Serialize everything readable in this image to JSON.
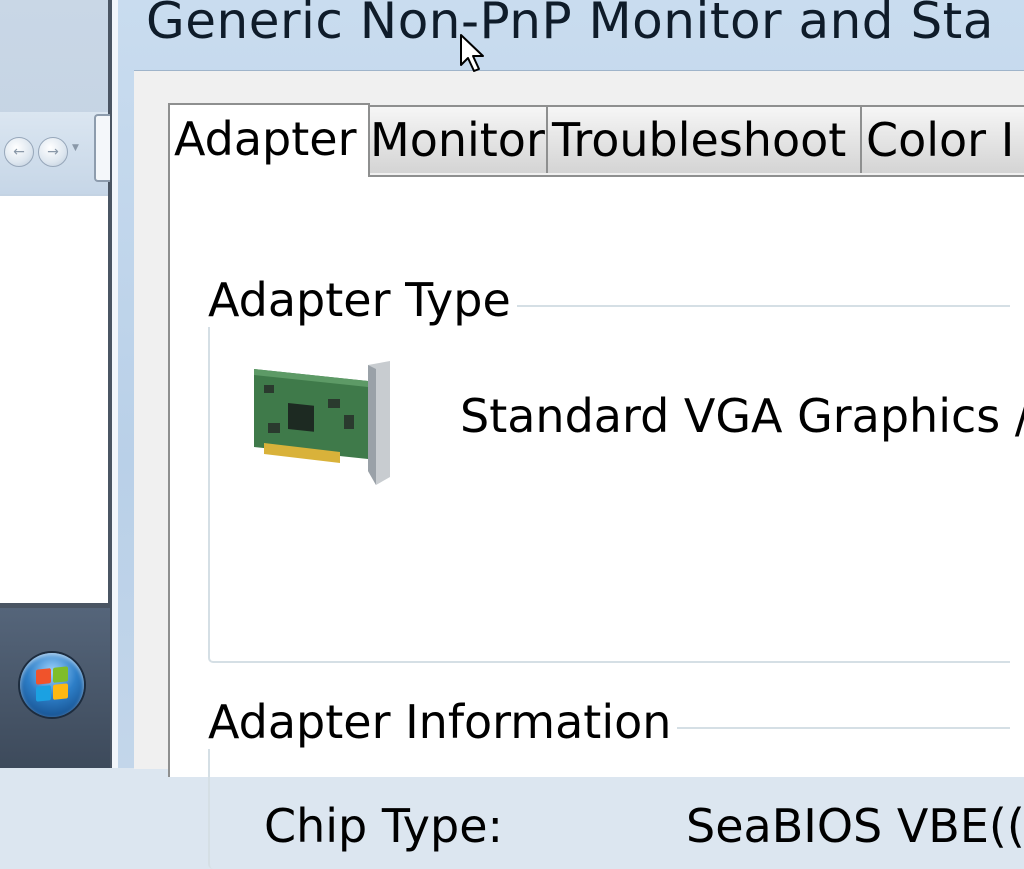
{
  "dialog": {
    "title": "Generic Non-PnP Monitor and Sta",
    "tabs": [
      {
        "label": "Adapter",
        "selected": true
      },
      {
        "label": "Monitor",
        "selected": false
      },
      {
        "label": "Troubleshoot",
        "selected": false
      },
      {
        "label": "Color I",
        "selected": false
      }
    ],
    "adapter_type": {
      "group_label": "Adapter Type",
      "adapter_name": "Standard VGA Graphics /",
      "icon": "graphics-card-icon"
    },
    "adapter_info": {
      "group_label": "Adapter Information",
      "chip_type_label": "Chip Type:",
      "chip_type_value": "SeaBIOS VBE(("
    }
  },
  "background_window": {
    "nav_icons": [
      "back-arrow-icon",
      "forward-arrow-icon",
      "chevron-down-icon"
    ]
  },
  "taskbar": {
    "start_icon": "windows-logo-icon"
  },
  "colors": {
    "title_bar": "#c9dcef",
    "dialog_body": "#f0f0f0",
    "tab_panel": "#ffffff",
    "taskbar": "#4a5563",
    "groupbox_border": "#d5dfe5"
  }
}
